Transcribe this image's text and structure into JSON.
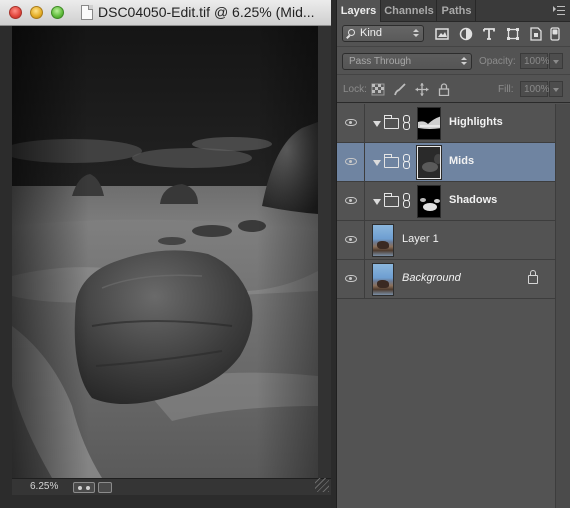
{
  "document": {
    "title": "DSC04050-Edit.tif @ 6.25% (Mid...",
    "zoom_level": "6.25%"
  },
  "layers_panel": {
    "tabs": [
      "Layers",
      "Channels",
      "Paths"
    ],
    "active_tab": "Layers",
    "filter": {
      "label": "Kind",
      "icons": [
        "pixel-filter-icon",
        "adjustment-filter-icon",
        "type-filter-icon",
        "shape-filter-icon",
        "smart-object-filter-icon",
        "filter-toggle-icon"
      ]
    },
    "blend_mode": "Pass Through",
    "opacity": {
      "label": "Opacity:",
      "value": "100%"
    },
    "lock": {
      "label": "Lock:",
      "icons": [
        "lock-transparent-icon",
        "lock-image-icon",
        "lock-position-icon",
        "lock-all-icon"
      ]
    },
    "fill": {
      "label": "Fill:",
      "value": "100%"
    },
    "layers": [
      {
        "name": "Highlights",
        "type": "group",
        "selected": false
      },
      {
        "name": "Mids",
        "type": "group",
        "selected": true
      },
      {
        "name": "Shadows",
        "type": "group",
        "selected": false
      },
      {
        "name": "Layer 1",
        "type": "pixel",
        "selected": false
      },
      {
        "name": "Background",
        "type": "background",
        "selected": false,
        "locked": true
      }
    ]
  },
  "colors": {
    "panel_bg": "#535353",
    "selected_row": "#6f84a1",
    "titlebar": "#dcdcdc"
  }
}
